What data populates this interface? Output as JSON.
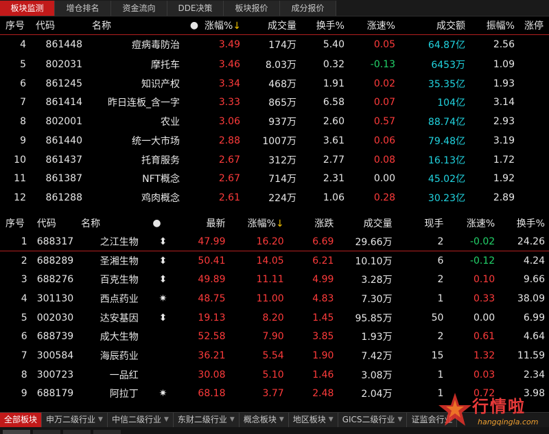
{
  "top_tabs": [
    "板块监测",
    "增仓排名",
    "资金流向",
    "DDE决策",
    "板块报价",
    "成分报价"
  ],
  "sector_table": {
    "headers": [
      "序号",
      "代码",
      "名称",
      "●",
      "涨幅%",
      "成交量",
      "换手%",
      "涨速%",
      "成交额",
      "振幅%",
      "涨停"
    ],
    "sort_arrow": "↓",
    "rows": [
      [
        "4",
        "861448",
        "痘病毒防治",
        "3.49",
        "174万",
        "5.40",
        "0.05",
        "64.87亿",
        "2.56"
      ],
      [
        "5",
        "802031",
        "摩托车",
        "3.46",
        "8.03万",
        "0.32",
        "-0.13",
        "6453万",
        "1.09"
      ],
      [
        "6",
        "861245",
        "知识产权",
        "3.34",
        "468万",
        "1.91",
        "0.02",
        "35.35亿",
        "1.93"
      ],
      [
        "7",
        "861414",
        "昨日连板_含一字",
        "3.33",
        "865万",
        "6.58",
        "0.07",
        "104亿",
        "3.14"
      ],
      [
        "8",
        "802001",
        "农业",
        "3.06",
        "937万",
        "2.60",
        "0.57",
        "88.74亿",
        "2.93"
      ],
      [
        "9",
        "861440",
        "统一大市场",
        "2.88",
        "1007万",
        "3.61",
        "0.06",
        "79.48亿",
        "3.19"
      ],
      [
        "10",
        "861437",
        "托育服务",
        "2.67",
        "312万",
        "2.77",
        "0.08",
        "16.13亿",
        "1.72"
      ],
      [
        "11",
        "861387",
        "NFT概念",
        "2.67",
        "714万",
        "2.31",
        "0.00",
        "45.02亿",
        "1.92"
      ],
      [
        "12",
        "861288",
        "鸡肉概念",
        "2.61",
        "224万",
        "1.06",
        "0.28",
        "30.23亿",
        "2.89"
      ]
    ]
  },
  "stock_table": {
    "headers": [
      "序号",
      "代码",
      "名称",
      "●",
      "最新",
      "涨幅%",
      "涨跌",
      "成交量",
      "现手",
      "涨速%",
      "换手%"
    ],
    "sort_arrow": "↓",
    "rows": [
      [
        "1",
        "688317",
        "之江生物",
        "⬍",
        "47.99",
        "16.20",
        "6.69",
        "29.66万",
        "2",
        "-0.02",
        "24.26"
      ],
      [
        "2",
        "688289",
        "圣湘生物",
        "⬍",
        "50.41",
        "14.05",
        "6.21",
        "10.10万",
        "6",
        "-0.12",
        "4.24"
      ],
      [
        "3",
        "688276",
        "百克生物",
        "⬍",
        "49.89",
        "11.11",
        "4.99",
        "3.28万",
        "2",
        "0.10",
        "9.66"
      ],
      [
        "4",
        "301130",
        "西点药业",
        "✷",
        "48.75",
        "11.00",
        "4.83",
        "7.30万",
        "1",
        "0.33",
        "38.09"
      ],
      [
        "5",
        "002030",
        "达安基因",
        "⬍",
        "19.13",
        "8.20",
        "1.45",
        "95.85万",
        "50",
        "0.00",
        "6.99"
      ],
      [
        "6",
        "688739",
        "成大生物",
        "",
        "52.58",
        "7.90",
        "3.85",
        "1.93万",
        "2",
        "0.61",
        "4.64"
      ],
      [
        "7",
        "300584",
        "海辰药业",
        "",
        "36.21",
        "5.54",
        "1.90",
        "7.42万",
        "15",
        "1.32",
        "11.59"
      ],
      [
        "8",
        "300723",
        "一品红",
        "",
        "30.08",
        "5.10",
        "1.46",
        "3.08万",
        "1",
        "0.03",
        "2.34"
      ],
      [
        "9",
        "688179",
        "阿拉丁",
        "✷",
        "68.18",
        "3.77",
        "2.48",
        "2.04万",
        "1",
        "0.72",
        "3.98"
      ]
    ]
  },
  "bottom_tabs": [
    "全部板块",
    "申万二级行业",
    "中信二级行业",
    "东财二级行业",
    "概念板块",
    "地区板块",
    "GICS二级行业",
    "证监会行业"
  ],
  "watermark": {
    "text": "行情啦",
    "url": "hangqingla.com"
  },
  "colors": {
    "accent": "#c21a1a",
    "up": "#ff3b3b",
    "down": "#22d36a",
    "amount": "#21d4e0"
  }
}
